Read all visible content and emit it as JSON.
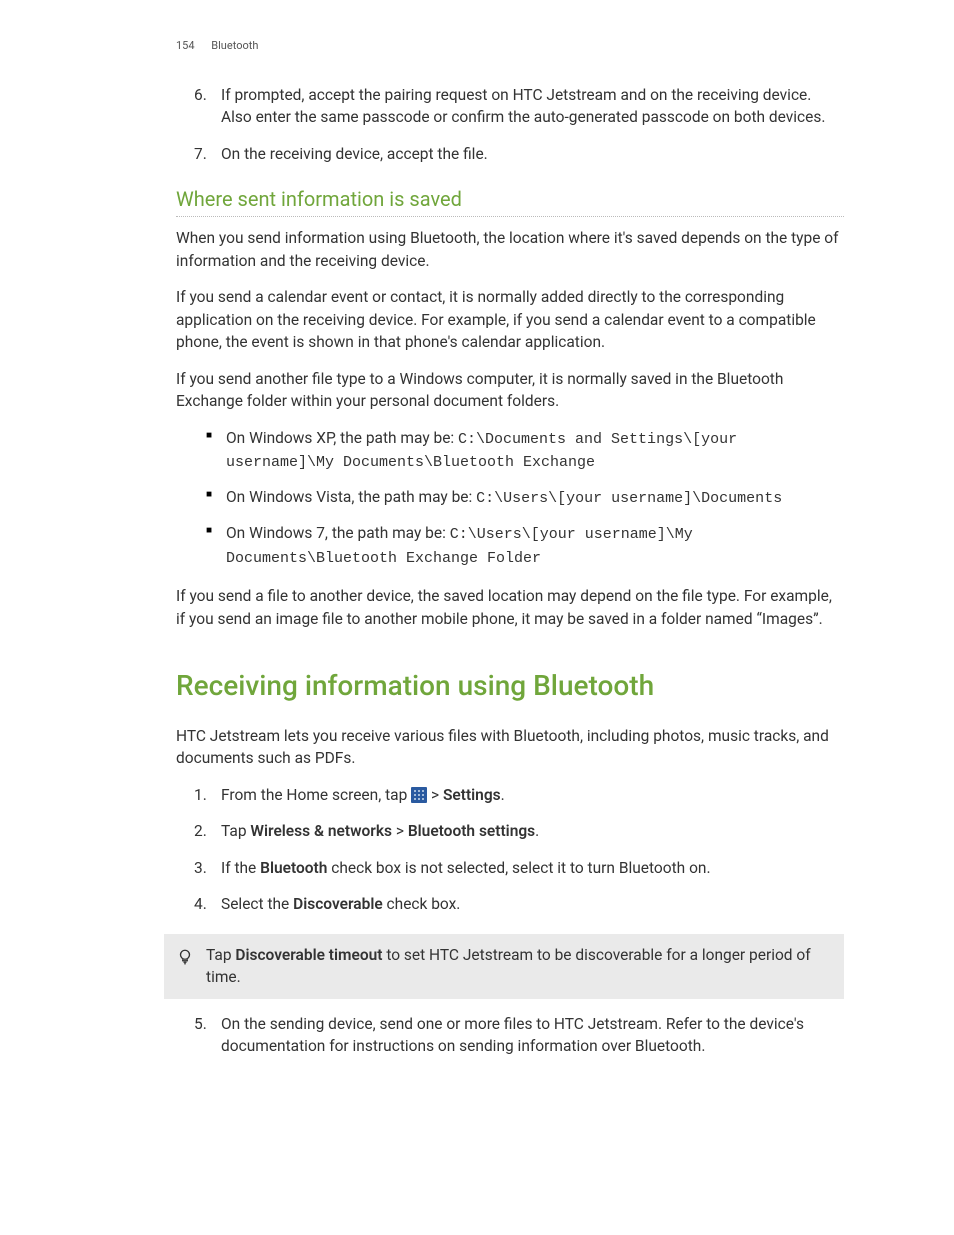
{
  "header": {
    "page_number": "154",
    "section": "Bluetooth"
  },
  "list1": {
    "item6": {
      "num": "6.",
      "text": "If prompted, accept the pairing request on HTC Jetstream and on the receiving device. Also enter the same passcode or confirm the auto-generated passcode on both devices."
    },
    "item7": {
      "num": "7.",
      "text": "On the receiving device, accept the file."
    }
  },
  "subheading": "Where sent information is saved",
  "para1": "When you send information using Bluetooth, the location where it's saved depends on the type of information and the receiving device.",
  "para2": "If you send a calendar event or contact, it is normally added directly to the corresponding application on the receiving device. For example, if you send a calendar event to a compatible phone, the event is shown in that phone's calendar application.",
  "para3": "If you send another file type to a Windows computer, it is normally saved in the Bluetooth Exchange folder within your personal document folders.",
  "bullets": {
    "xp": {
      "lead": "On Windows XP, the path may be: ",
      "code": "C:\\Documents and Settings\\[your username]\\My Documents\\Bluetooth Exchange"
    },
    "vista": {
      "lead": "On Windows Vista, the path may be: ",
      "code": "C:\\Users\\[your username]\\Documents"
    },
    "win7": {
      "lead": "On Windows 7, the path may be: ",
      "code": "C:\\Users\\[your username]\\My Documents\\Bluetooth Exchange Folder"
    }
  },
  "para4": "If you send a file to another device, the saved location may depend on the file type. For example, if you send an image file to another mobile phone, it may be saved in a folder named “Images”.",
  "mainheading": "Receiving information using Bluetooth",
  "para5": "HTC Jetstream lets you receive various files with Bluetooth, including photos, music tracks, and documents such as PDFs.",
  "steps2": {
    "s1": {
      "num": "1.",
      "lead": "From the Home screen, tap ",
      "after": " > ",
      "bold": "Settings",
      "end": "."
    },
    "s2": {
      "num": "2.",
      "lead": "Tap ",
      "b1": "Wireless & networks",
      "mid": " > ",
      "b2": "Bluetooth settings",
      "end": "."
    },
    "s3": {
      "num": "3.",
      "lead": "If the ",
      "b1": "Bluetooth",
      "rest": " check box is not selected, select it to turn Bluetooth on."
    },
    "s4": {
      "num": "4.",
      "lead": "Select the ",
      "b1": "Discoverable",
      "rest": " check box."
    },
    "s5": {
      "num": "5.",
      "text": "On the sending device, send one or more files to HTC Jetstream. Refer to the device's documentation for instructions on sending information over Bluetooth."
    }
  },
  "tip": {
    "lead": "Tap ",
    "b1": "Discoverable timeout",
    "rest": " to set HTC Jetstream to be discoverable for a longer period of time."
  }
}
